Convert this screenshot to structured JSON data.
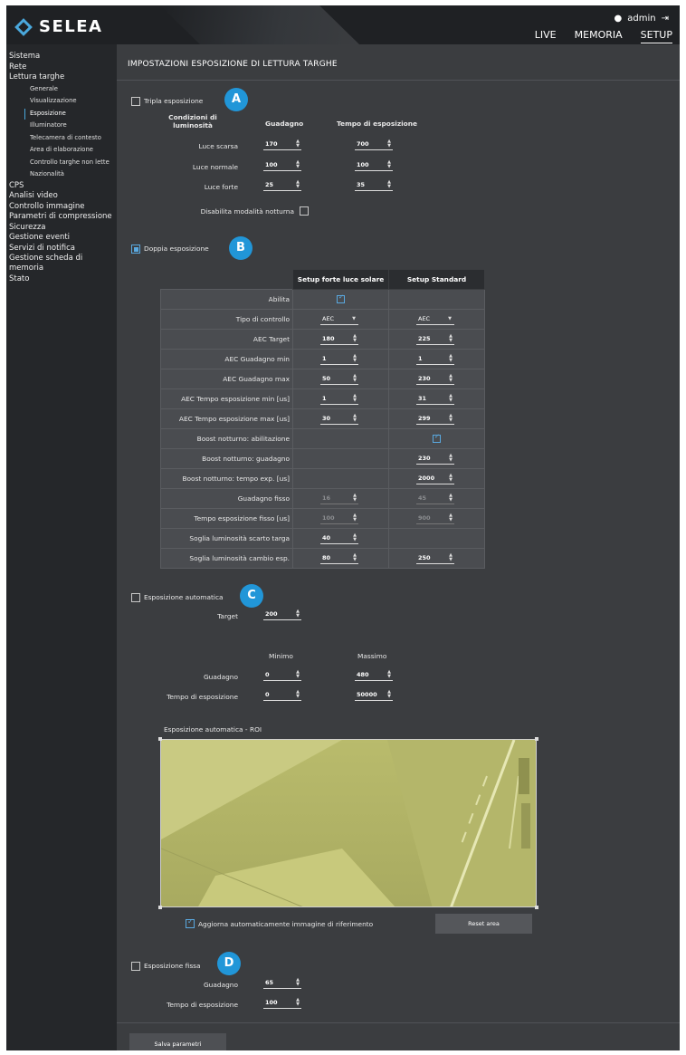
{
  "header": {
    "logo": "SELEA",
    "user": "admin",
    "nav": [
      "LIVE",
      "MEMORIA",
      "SETUP"
    ],
    "nav_active": "SETUP"
  },
  "sidebar": {
    "items": [
      {
        "label": "Sistema",
        "level": 0
      },
      {
        "label": "Rete",
        "level": 0
      },
      {
        "label": "Lettura targhe",
        "level": 0
      },
      {
        "label": "Generale",
        "level": 1
      },
      {
        "label": "Visualizzazione",
        "level": 1
      },
      {
        "label": "Esposizione",
        "level": 1,
        "active": true
      },
      {
        "label": "Illuminatore",
        "level": 1
      },
      {
        "label": "Telecamera di contesto",
        "level": 1
      },
      {
        "label": "Area di elaborazione",
        "level": 1
      },
      {
        "label": "Controllo targhe non lette",
        "level": 1
      },
      {
        "label": "Nazionalità",
        "level": 1
      },
      {
        "label": "CPS",
        "level": 0
      },
      {
        "label": "Analisi video",
        "level": 0
      },
      {
        "label": "Controllo immagine",
        "level": 0
      },
      {
        "label": "Parametri di compressione",
        "level": 0
      },
      {
        "label": "Sicurezza",
        "level": 0
      },
      {
        "label": "Gestione eventi",
        "level": 0
      },
      {
        "label": "Servizi di notifica",
        "level": 0
      },
      {
        "label": "Gestione scheda di memoria",
        "level": 0
      },
      {
        "label": "Stato",
        "level": 0
      }
    ]
  },
  "page": {
    "title": "IMPOSTAZIONI ESPOSIZIONE DI LETTURA TARGHE"
  },
  "triple": {
    "label": "Tripla esposizione",
    "badge": "A",
    "checked": false,
    "col_cond": "Condizioni di luminosità",
    "col_gain": "Guadagno",
    "col_time": "Tempo di esposizione",
    "rows": [
      {
        "label": "Luce scarsa",
        "gain": "170",
        "time": "700"
      },
      {
        "label": "Luce normale",
        "gain": "100",
        "time": "100"
      },
      {
        "label": "Luce forte",
        "gain": "25",
        "time": "35"
      }
    ],
    "night_label": "Disabilita modalità notturna"
  },
  "double": {
    "label": "Doppia esposizione",
    "badge": "B",
    "checked": true,
    "col1": "Setup forte luce solare",
    "col2": "Setup Standard",
    "rows": [
      {
        "label": "Abilita",
        "c1": {
          "type": "check"
        },
        "c2": {
          "type": "none"
        }
      },
      {
        "label": "Tipo di controllo",
        "c1": {
          "type": "select",
          "v": "AEC"
        },
        "c2": {
          "type": "select",
          "v": "AEC"
        }
      },
      {
        "label": "AEC Target",
        "c1": {
          "type": "spin",
          "v": "180"
        },
        "c2": {
          "type": "spin",
          "v": "225"
        }
      },
      {
        "label": "AEC Guadagno min",
        "c1": {
          "type": "spin",
          "v": "1"
        },
        "c2": {
          "type": "spin",
          "v": "1"
        }
      },
      {
        "label": "AEC Guadagno max",
        "c1": {
          "type": "spin",
          "v": "50"
        },
        "c2": {
          "type": "spin",
          "v": "230"
        }
      },
      {
        "label": "AEC Tempo esposizione min [us]",
        "c1": {
          "type": "spin",
          "v": "1"
        },
        "c2": {
          "type": "spin",
          "v": "31"
        }
      },
      {
        "label": "AEC Tempo esposizione max [us]",
        "c1": {
          "type": "spin",
          "v": "30"
        },
        "c2": {
          "type": "spin",
          "v": "299"
        }
      },
      {
        "label": "Boost notturno: abilitazione",
        "c1": {
          "type": "none"
        },
        "c2": {
          "type": "check"
        }
      },
      {
        "label": "Boost notturno: guadagno",
        "c1": {
          "type": "none"
        },
        "c2": {
          "type": "spin",
          "v": "230"
        }
      },
      {
        "label": "Boost notturno: tempo exp. [us]",
        "c1": {
          "type": "none"
        },
        "c2": {
          "type": "spin",
          "v": "2000"
        }
      },
      {
        "label": "Guadagno fisso",
        "c1": {
          "type": "spin-dis",
          "v": "16"
        },
        "c2": {
          "type": "spin-dis",
          "v": "45"
        }
      },
      {
        "label": "Tempo esposizione fisso [us]",
        "c1": {
          "type": "spin-dis",
          "v": "100"
        },
        "c2": {
          "type": "spin-dis",
          "v": "900"
        }
      },
      {
        "label": "Soglia luminosità scarto targa",
        "c1": {
          "type": "spin",
          "v": "40"
        },
        "c2": {
          "type": "none"
        }
      },
      {
        "label": "Soglia luminosità cambio esp.",
        "c1": {
          "type": "spin",
          "v": "80"
        },
        "c2": {
          "type": "spin",
          "v": "250"
        }
      }
    ]
  },
  "auto": {
    "label": "Esposizione automatica",
    "badge": "C",
    "checked": false,
    "target_label": "Target",
    "target": "200",
    "min_label": "Minimo",
    "max_label": "Massimo",
    "gain_label": "Guadagno",
    "gain_min": "0",
    "gain_max": "480",
    "time_label": "Tempo di esposizione",
    "time_min": "0",
    "time_max": "50000",
    "roi_title": "Esposizione automatica - ROI",
    "update_label": "Aggiorna automaticamente immagine di riferimento",
    "reset_label": "Reset area"
  },
  "fixed": {
    "label": "Esposizione fissa",
    "badge": "D",
    "checked": false,
    "gain_label": "Guadagno",
    "gain": "65",
    "time_label": "Tempo di esposizione",
    "time": "100"
  },
  "save_label": "Salva parametri",
  "colors": {
    "accent": "#2196d8",
    "panel": "#3b3d40",
    "sidebar": "#25272a",
    "roi": "#c6c77a"
  }
}
